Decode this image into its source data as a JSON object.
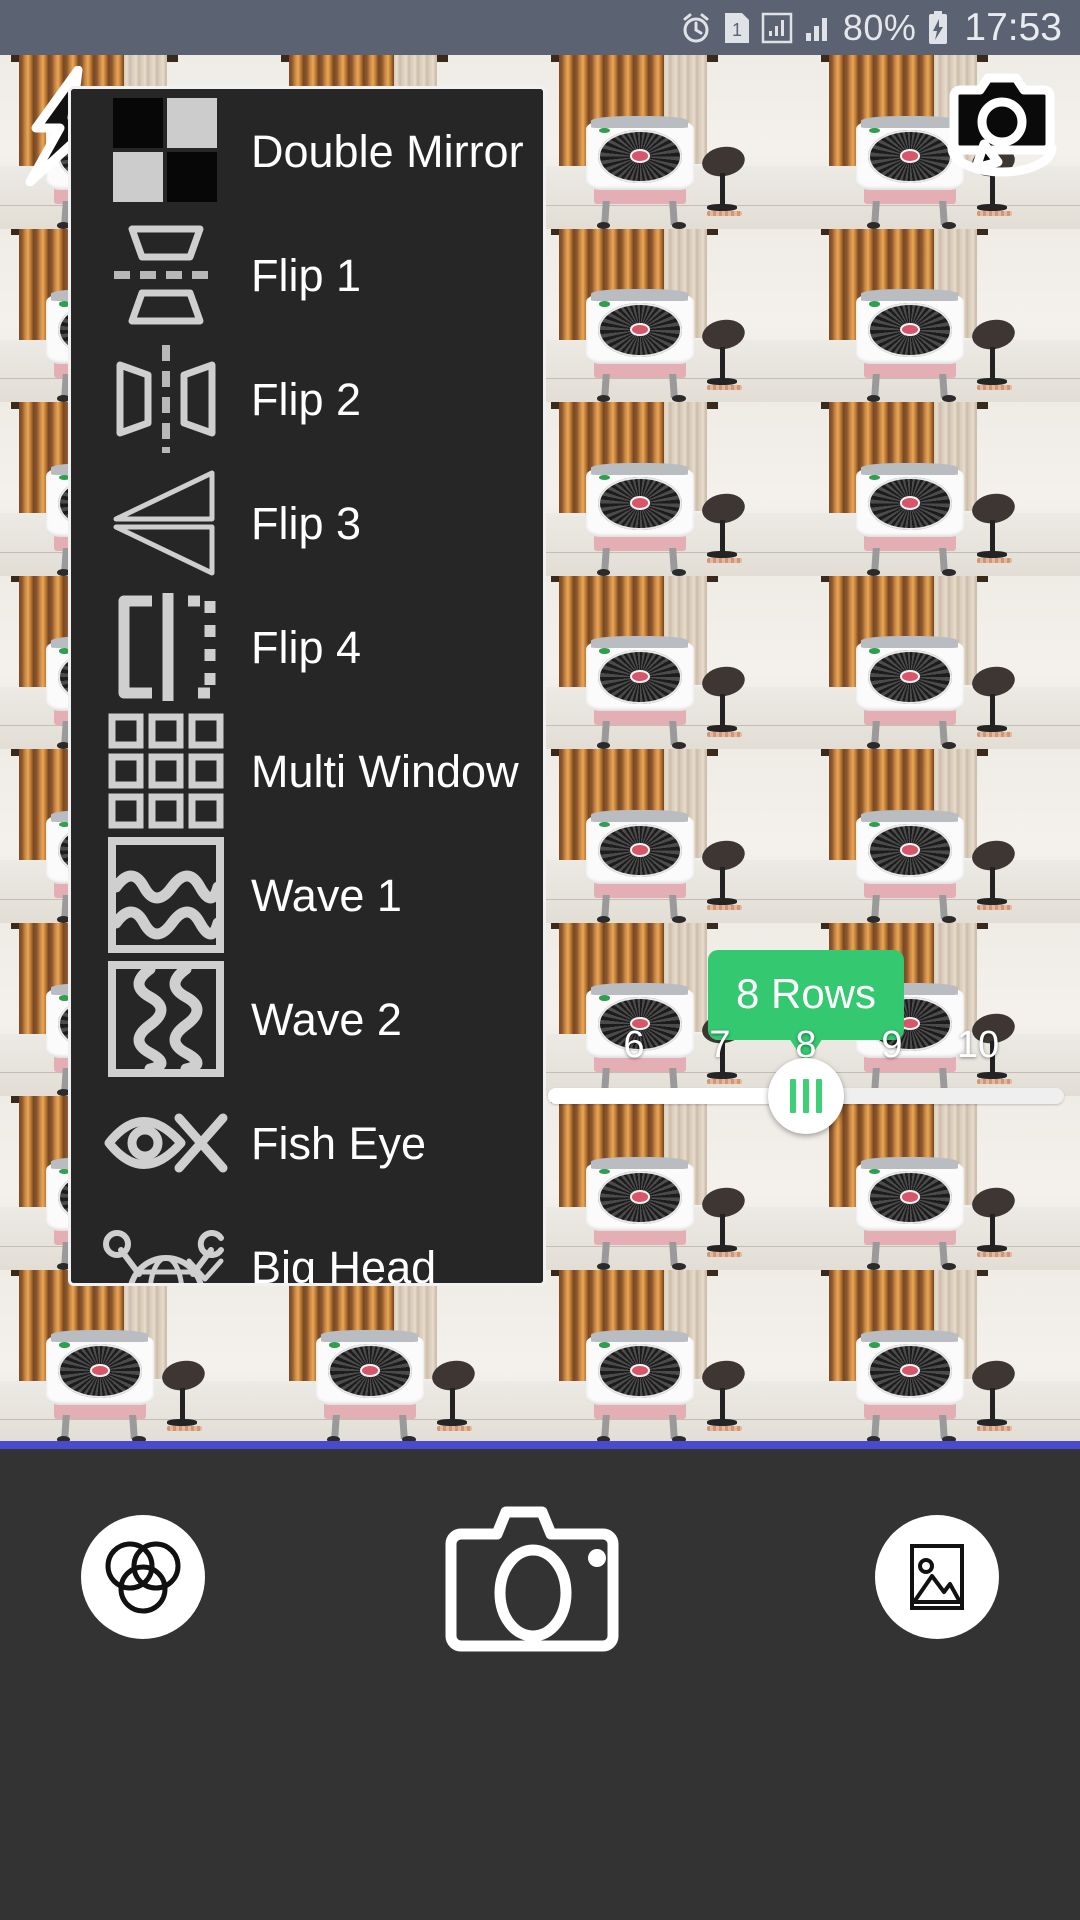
{
  "status_bar": {
    "background_color": "#5b6272",
    "icons": [
      "alarm-clock-icon",
      "sim-card-1-icon",
      "signal-outline-icon",
      "signal-bars-icon"
    ],
    "sim_label": "1",
    "battery_percent": "80%",
    "battery_state": "charging",
    "time": "17:53"
  },
  "camera": {
    "flash_icon": "flash-bolt-icon",
    "switch_camera_icon": "switch-camera-icon",
    "preview_description": "tiled repeating live camera preview",
    "grid_columns": 4,
    "grid_rows": 8,
    "preview_bottom_accent_color": "#4a4ad1"
  },
  "rows_slider": {
    "tooltip_label": "8 Rows",
    "tooltip_color": "#34c871",
    "value": 8,
    "min": 5,
    "max": 11,
    "tick_labels": [
      "6",
      "7",
      "8",
      "9",
      "10"
    ],
    "thumb_accent_color": "#3ecf77",
    "track_color": "#efefef"
  },
  "effects_menu": {
    "background_color": "#262626",
    "scroll_chevron_icon": "chevron-down-icon",
    "items": [
      {
        "label": "Double Mirror",
        "icon": "double-mirror-icon"
      },
      {
        "label": "Flip 1",
        "icon": "flip-horizontal-icon"
      },
      {
        "label": "Flip 2",
        "icon": "flip-vertical-icon"
      },
      {
        "label": "Flip 3",
        "icon": "flip-triangle-icon"
      },
      {
        "label": "Flip 4",
        "icon": "flip-bracket-icon"
      },
      {
        "label": "Multi Window",
        "icon": "grid-3x3-icon"
      },
      {
        "label": "Wave 1",
        "icon": "wave-horizontal-icon"
      },
      {
        "label": "Wave 2",
        "icon": "wave-vertical-icon"
      },
      {
        "label": "Fish Eye",
        "icon": "fish-eye-icon"
      },
      {
        "label": "Big Head",
        "icon": "big-head-globe-icon"
      }
    ]
  },
  "bottom_bar": {
    "background_color": "#333333",
    "effects_button_icon": "three-overlapping-circles-icon",
    "shutter_button_icon": "camera-shutter-icon",
    "gallery_button_icon": "gallery-image-icon"
  }
}
